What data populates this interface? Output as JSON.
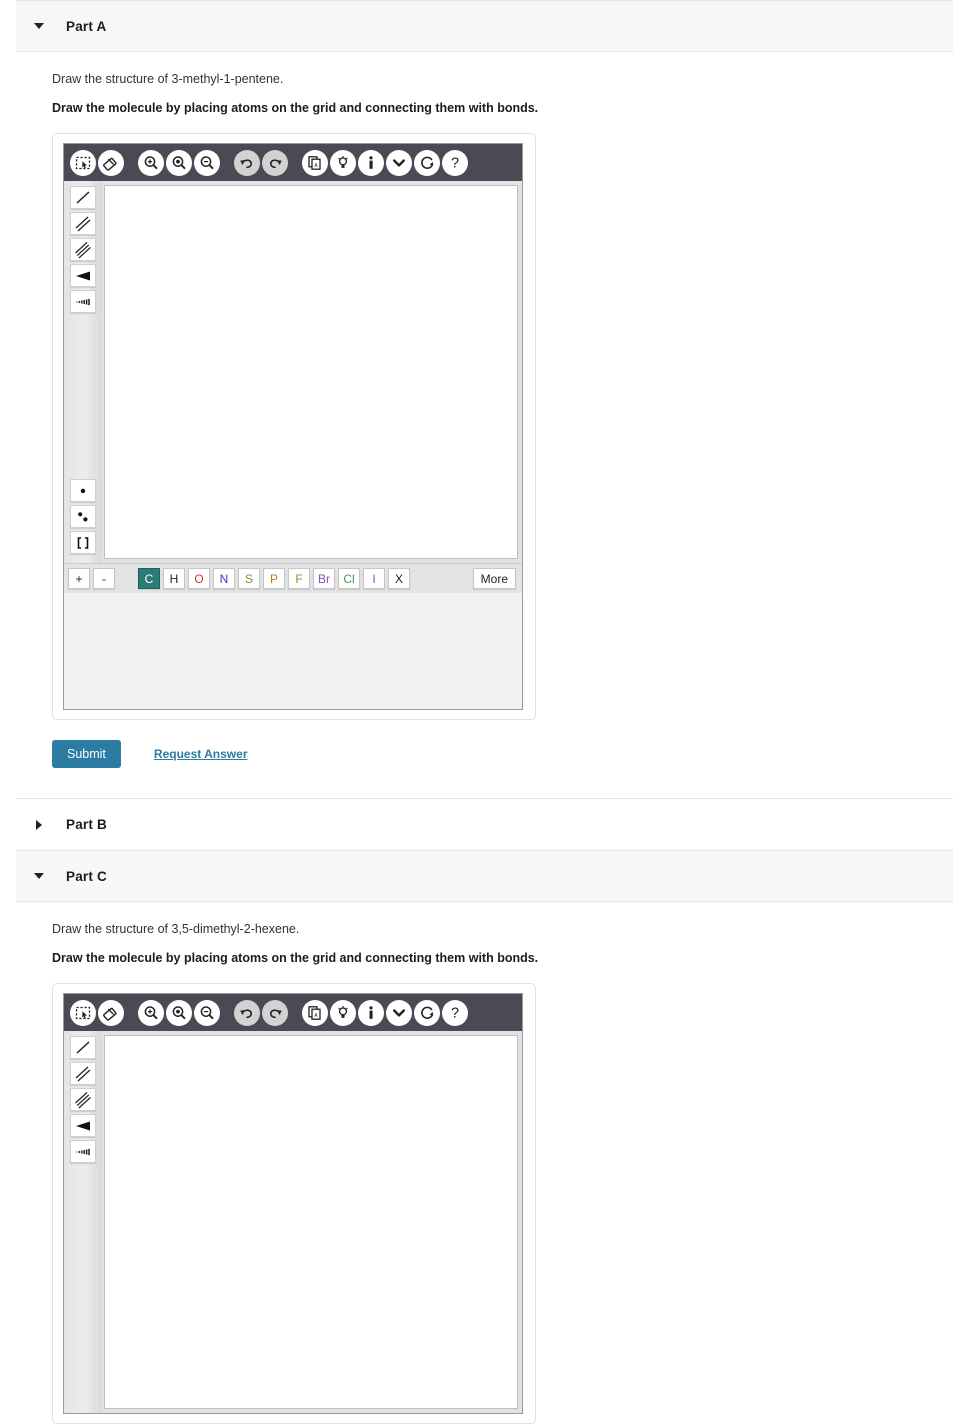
{
  "theme": {
    "header_bg": "#f7f7f7",
    "toolbar_bg": "#4a4a55",
    "accent_blue": "#2b7ba3",
    "selected_element_bg": "#2a7c79"
  },
  "parts": [
    {
      "id": "part-a",
      "title": "Part A",
      "expanded": true,
      "prompt": "Draw the structure of 3-methyl-1-pentene.",
      "instruction": "Draw the molecule by placing atoms on the grid and connecting them with bonds."
    },
    {
      "id": "part-b",
      "title": "Part B",
      "expanded": false
    },
    {
      "id": "part-c",
      "title": "Part C",
      "expanded": true,
      "prompt": "Draw the structure of 3,5-dimethyl-2-hexene.",
      "instruction": "Draw the molecule by placing atoms on the grid and connecting them with bonds."
    }
  ],
  "editor": {
    "toolbar": [
      {
        "name": "select-lasso-icon",
        "title": "Select"
      },
      {
        "name": "eraser-icon",
        "title": "Erase"
      },
      {
        "name": "zoom-in-icon",
        "title": "Zoom In"
      },
      {
        "name": "zoom-fit-icon",
        "title": "Zoom to Fit"
      },
      {
        "name": "zoom-out-icon",
        "title": "Zoom Out"
      },
      {
        "name": "undo-icon",
        "title": "Undo",
        "disabled": true
      },
      {
        "name": "redo-icon",
        "title": "Redo"
      },
      {
        "name": "copy-paste-icon",
        "title": "Copy"
      },
      {
        "name": "lightbulb-icon",
        "title": "Hint"
      },
      {
        "name": "info-icon",
        "title": "Information"
      },
      {
        "name": "chevron-down-icon",
        "title": "More Options"
      },
      {
        "name": "reset-icon",
        "title": "Reset"
      },
      {
        "name": "help-icon",
        "title": "Help"
      }
    ],
    "bond_tools": [
      {
        "name": "single-bond-tool",
        "title": "Single bond"
      },
      {
        "name": "double-bond-tool",
        "title": "Double bond"
      },
      {
        "name": "triple-bond-tool",
        "title": "Triple bond"
      },
      {
        "name": "wedge-bond-tool",
        "title": "Wedge bond"
      },
      {
        "name": "hash-bond-tool",
        "title": "Hash bond"
      }
    ],
    "charge_tools": [
      {
        "name": "radical-tool",
        "title": "Single electron"
      },
      {
        "name": "lone-pair-tool",
        "title": "Lone pair"
      },
      {
        "name": "brackets-tool",
        "title": "Brackets"
      }
    ],
    "charge_buttons": [
      {
        "label": "+",
        "name": "increase-charge-button"
      },
      {
        "label": "-",
        "name": "decrease-charge-button"
      }
    ],
    "elements": [
      {
        "symbol": "C",
        "color": "#ffffff",
        "selected": true
      },
      {
        "symbol": "H",
        "color": "#222222",
        "selected": false
      },
      {
        "symbol": "O",
        "color": "#d8322b",
        "selected": false
      },
      {
        "symbol": "N",
        "color": "#2a3ed8",
        "selected": false
      },
      {
        "symbol": "S",
        "color": "#8a8a2b",
        "selected": false
      },
      {
        "symbol": "P",
        "color": "#c07a24",
        "selected": false
      },
      {
        "symbol": "F",
        "color": "#a08436",
        "selected": false
      },
      {
        "symbol": "Br",
        "color": "#8a4fc0",
        "selected": false
      },
      {
        "symbol": "Cl",
        "color": "#3f9c44",
        "selected": false
      },
      {
        "symbol": "I",
        "color": "#8a4fc0",
        "selected": false
      },
      {
        "symbol": "X",
        "color": "#222222",
        "selected": false
      }
    ],
    "more_label": "More"
  },
  "actions": {
    "submit_label": "Submit",
    "request_answer_label": "Request Answer"
  }
}
